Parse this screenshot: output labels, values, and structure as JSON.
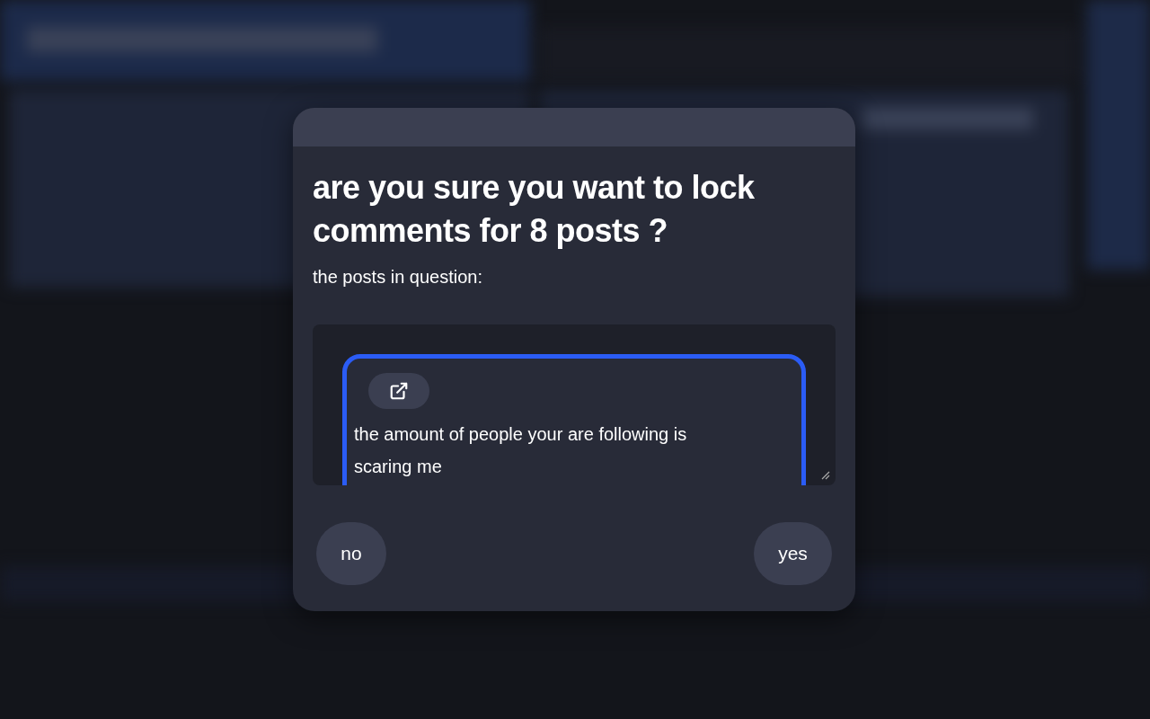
{
  "dialog": {
    "title": "are you sure you want to lock comments for 8 posts ?",
    "subtitle": "the posts in question:",
    "posts": [
      {
        "text": "the amount of people your are following is scaring me",
        "selected": true
      }
    ],
    "buttons": [
      {
        "label": "no",
        "kind": "cancel"
      },
      {
        "label": "yes",
        "kind": "confirm"
      }
    ]
  }
}
